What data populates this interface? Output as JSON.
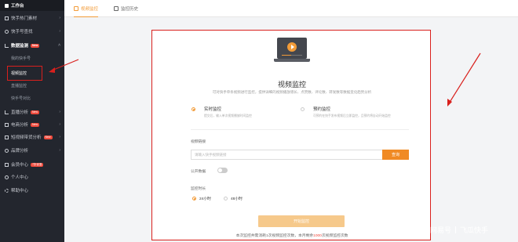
{
  "sidebar": {
    "items": [
      {
        "label": "工作台"
      },
      {
        "label": "快手热门素材"
      },
      {
        "label": "快手号查找"
      },
      {
        "label": "数据监测",
        "badge": "New"
      },
      {
        "label": "我的快手号"
      },
      {
        "label": "视频监控"
      },
      {
        "label": "直播监控"
      },
      {
        "label": "快手号对比"
      },
      {
        "label": "直播分析",
        "badge": "New"
      },
      {
        "label": "电商分析",
        "badge": "New"
      },
      {
        "label": "短视频带货分析",
        "badge": "New"
      },
      {
        "label": "品牌分析"
      },
      {
        "label": "会员中心",
        "badge": "7折优惠"
      },
      {
        "label": "个人中心"
      },
      {
        "label": "帮助中心"
      }
    ]
  },
  "tabs": [
    {
      "label": "视频监控"
    },
    {
      "label": "监控历史"
    }
  ],
  "panel": {
    "title": "视频监控",
    "description": "可对快手单条视频进行监控，提供详细的视频播放增长、点赞数、评论数、转发数等数据变化趋势分析",
    "modes": [
      {
        "label": "实时监控",
        "sub": "提交后，输入单次视频播放时间监控"
      },
      {
        "label": "预约监控",
        "sub": "可预约在快手发布视频后立即监控，且预约将自动开始监控"
      }
    ],
    "video_url_label": "视频链接",
    "video_url_placeholder": "请输入快手视频链接",
    "query_label": "查询",
    "public_label": "公开数据",
    "duration_label": "监控时长",
    "durations": [
      "24小时",
      "48小时"
    ],
    "start_label": "开始监控",
    "footnote_before": "本次监控共需消耗1次视频监控次数，本月剩余",
    "footnote_highlight": "1000",
    "footnote_after": "次视频监控次数"
  },
  "watermark": {
    "left": "网易号",
    "right": "飞瓜快手"
  },
  "colors": {
    "accent": "#f29b38",
    "sidebar_bg": "#23262e",
    "annotation_red": "#d9201d"
  }
}
